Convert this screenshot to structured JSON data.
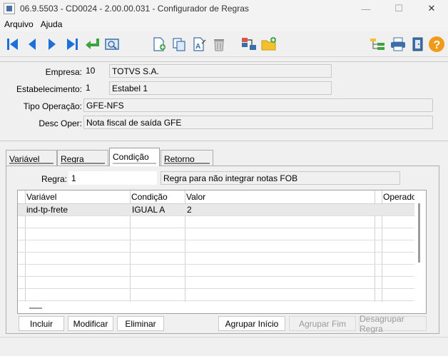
{
  "window": {
    "title": "06.9.5503 - CD0024 - 2.00.00.031 - Configurador de Regras",
    "minimize_glyph": "—",
    "maximize_glyph": "☐",
    "close_glyph": "✕"
  },
  "menu": {
    "items": [
      "Arquivo",
      "Ajuda"
    ]
  },
  "toolbar": {
    "icons": [
      "first-record-icon",
      "previous-record-icon",
      "next-record-icon",
      "last-record-icon",
      "goto-icon",
      "search-icon",
      "new-record-icon",
      "copy-record-icon",
      "edit-record-icon",
      "delete-record-icon",
      "rules-relation-icon",
      "new-folder-icon",
      "tree-view-icon",
      "print-icon",
      "exit-icon",
      "help-icon"
    ]
  },
  "header": {
    "empresa_label": "Empresa:",
    "empresa_code": "10",
    "empresa_name": "TOTVS S.A.",
    "estabelecimento_label": "Estabelecimento:",
    "estabelecimento_code": "1",
    "estabelecimento_name": "Estabel 1",
    "tipo_operacao_label": "Tipo Operação:",
    "tipo_operacao_value": "GFE-NFS",
    "desc_oper_label": "Desc Oper:",
    "desc_oper_value": "Nota fiscal de saída GFE"
  },
  "tabs": [
    "Variável",
    "Regra",
    "Condição",
    "Retorno"
  ],
  "active_tab": "Condição",
  "condicao": {
    "regra_label": "Regra:",
    "regra_code": "1",
    "regra_desc": "Regra para não integrar notas FOB",
    "grid": {
      "columns": [
        "Variável",
        "Condição",
        "Valor",
        "Operador"
      ],
      "rows": [
        [
          "ind-tp-frete",
          "IGUAL A",
          "2",
          ""
        ]
      ]
    }
  },
  "buttons": {
    "incluir": "Incluir",
    "modificar": "Modificar",
    "eliminar": "Eliminar",
    "agrupar_inicio": "Agrupar Início",
    "agrupar_fim": "Agrupar Fim",
    "desagrupar_regra": "Desagrupar Regra"
  },
  "colors": {
    "nav_blue": "#1e6fd9",
    "nav_green": "#3ea33e",
    "folder_yellow": "#f2c12e",
    "help_orange": "#f09a1a"
  }
}
